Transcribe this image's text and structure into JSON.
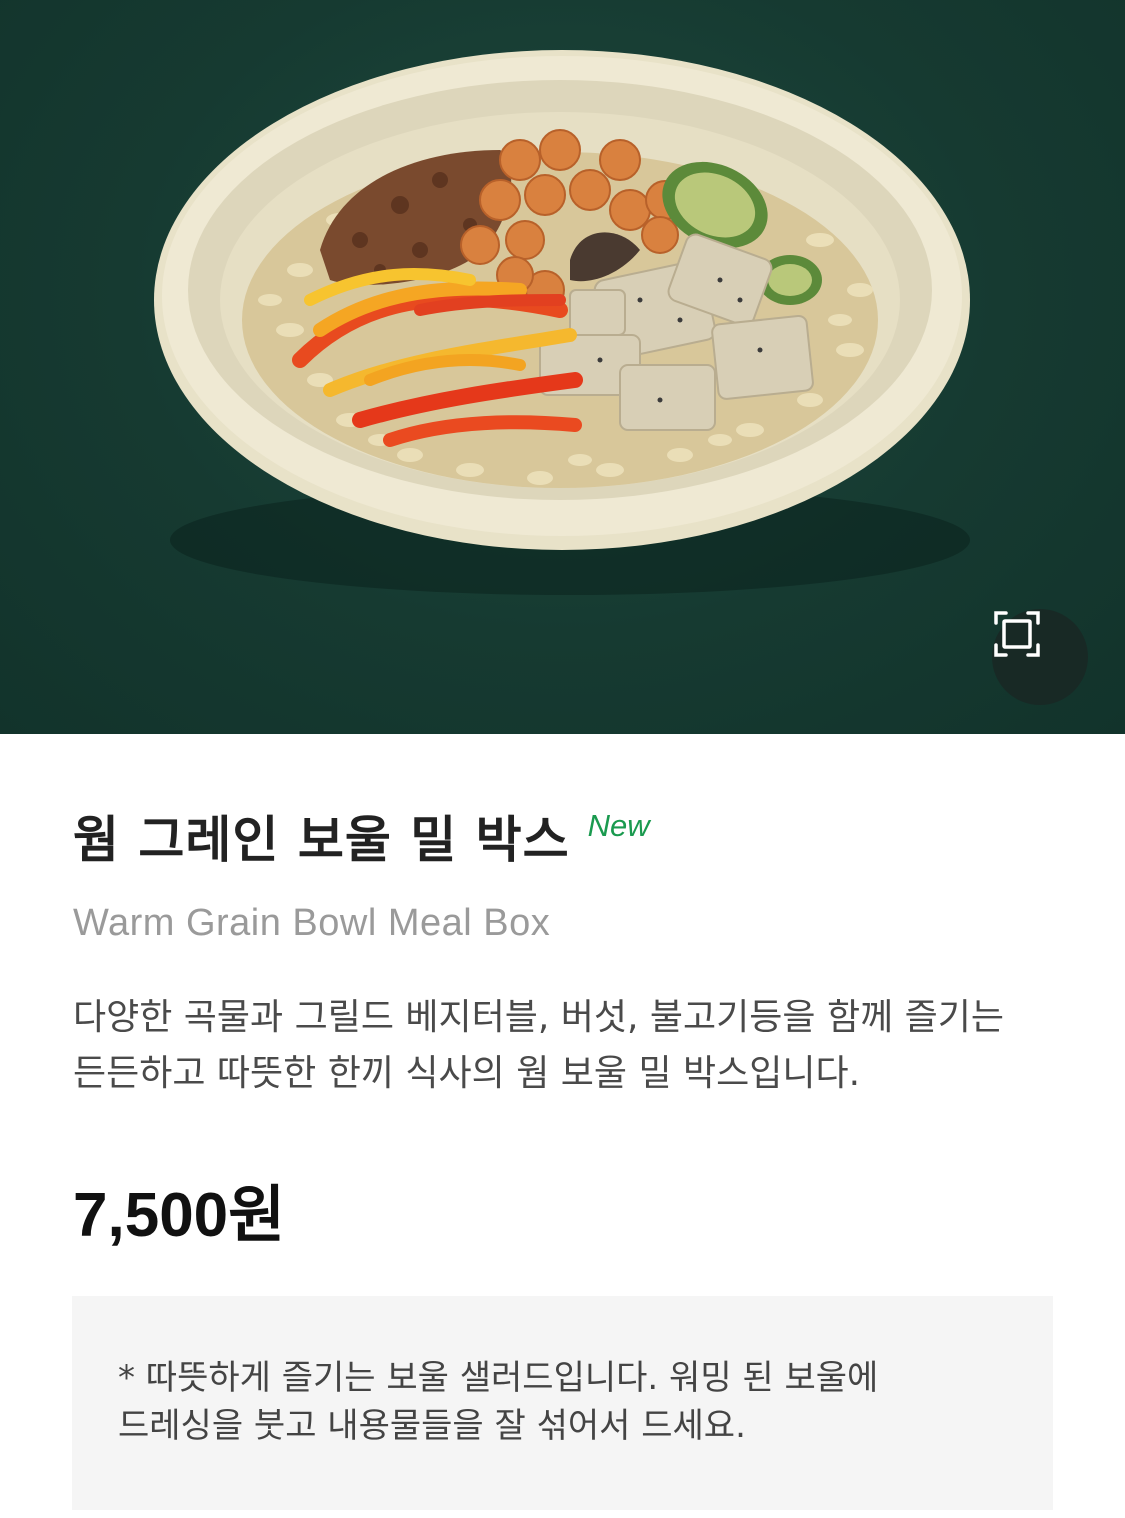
{
  "hero": {
    "image_alt": "warm grain bowl photo",
    "zoom_icon": "expand-icon"
  },
  "product": {
    "title": "웜 그레인 보울 밀 박스",
    "badge": "New",
    "subtitle": "Warm Grain Bowl Meal Box",
    "description": "다양한 곡물과 그릴드 베지터블, 버섯, 불고기등을 함께 즐기는 든든하고 따뜻한 한끼 식사의 웜 보울 밀 박스입니다.",
    "price": "7,500원"
  },
  "notice": {
    "text": "* 따뜻하게 즐기는 보울 샐러드입니다. 워밍 된 보울에 드레싱을 붓고 내용물들을 잘 섞어서 드세요."
  },
  "colors": {
    "hero_background": "#163a31",
    "badge": "#1a9a4f",
    "notice_background": "#f5f5f5"
  }
}
